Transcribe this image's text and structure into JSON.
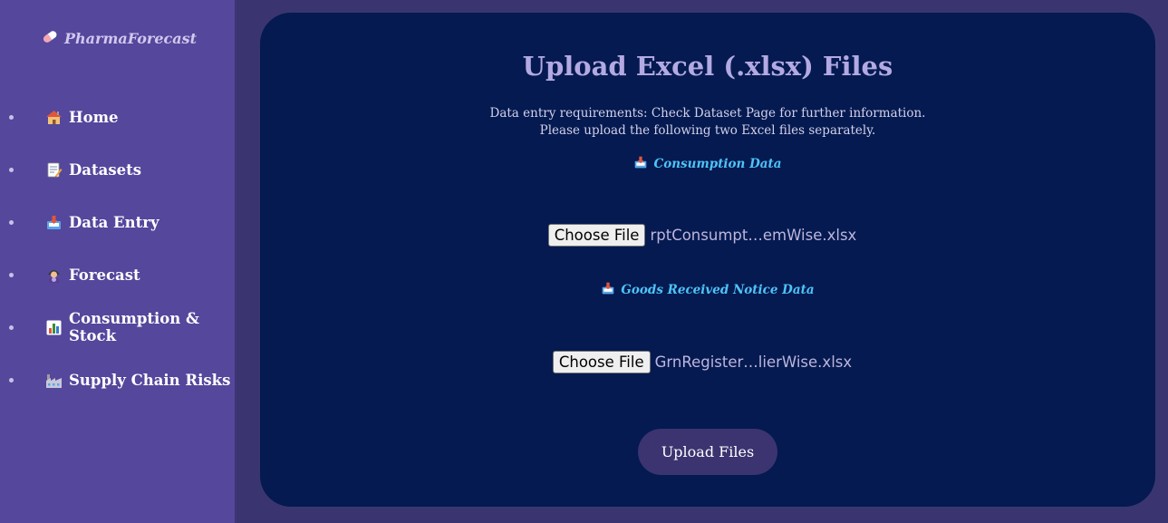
{
  "sidebar": {
    "logo": "PharmaForecast",
    "items": [
      {
        "label": "Home",
        "icon": "house-icon"
      },
      {
        "label": "Datasets",
        "icon": "memo-icon"
      },
      {
        "label": "Data Entry",
        "icon": "inbox-tray-icon"
      },
      {
        "label": "Forecast",
        "icon": "fortune-teller-icon"
      },
      {
        "label": "Consumption & Stock",
        "icon": "bar-chart-icon"
      },
      {
        "label": "Supply Chain Risks",
        "icon": "factory-icon"
      }
    ]
  },
  "main": {
    "title": "Upload Excel (.xlsx) Files",
    "requirements_line1": "Data entry requirements: Check Dataset Page for further information.",
    "requirements_line2": "Please upload the following two Excel files separately.",
    "sections": [
      {
        "label": "Consumption Data",
        "icon": "inbox-tray-icon",
        "button": "Choose File",
        "file_name": "rptConsumpt…emWise.xlsx"
      },
      {
        "label": "Goods Received Notice Data",
        "icon": "inbox-tray-icon",
        "button": "Choose File",
        "file_name": "GrnRegister…lierWise.xlsx"
      }
    ],
    "upload_button": "Upload Files"
  },
  "colors": {
    "page_bg": "#3a3570",
    "sidebar_bg": "#55479c",
    "panel_bg": "#041a50",
    "title": "#b3a9e3",
    "section_label": "#4fc3f7",
    "upload_button_bg": "#3b3470"
  }
}
